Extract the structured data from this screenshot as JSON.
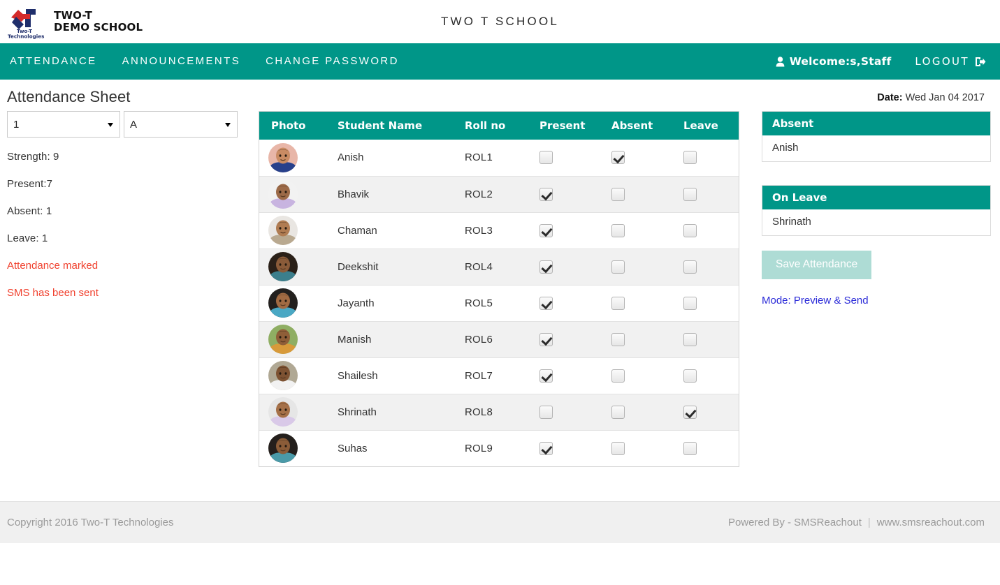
{
  "brand": {
    "logo_icon": "two-t-logo-icon",
    "logo_line1": "TWO-T",
    "logo_line2": "DEMO SCHOOL",
    "logo_sub1": "Two-T",
    "logo_sub2": "Technologies"
  },
  "header": {
    "school_title": "TWO T SCHOOL"
  },
  "nav": {
    "items": [
      {
        "label": "ATTENDANCE",
        "name": "nav-attendance"
      },
      {
        "label": "ANNOUNCEMENTS",
        "name": "nav-announcements"
      },
      {
        "label": "CHANGE PASSWORD",
        "name": "nav-change-password"
      }
    ],
    "welcome": "Welcome:s,Staff",
    "welcome_icon": "user-icon",
    "logout": "LOGOUT",
    "logout_icon": "sign-out-icon"
  },
  "page": {
    "title": "Attendance Sheet",
    "date_label": "Date:",
    "date_value": "Wed Jan 04 2017"
  },
  "filters": {
    "class_value": "1",
    "section_value": "A"
  },
  "stats": {
    "strength": "Strength: 9",
    "present": "Present:7",
    "absent": "Absent: 1",
    "leave": "Leave: 1",
    "message_marked": "Attendance marked",
    "message_sms": "SMS has been sent"
  },
  "table": {
    "columns": [
      "Photo",
      "Student Name",
      "Roll no",
      "Present",
      "Absent",
      "Leave"
    ],
    "rows": [
      {
        "name": "Anish",
        "roll": "ROL1",
        "present": false,
        "absent": true,
        "leave": false,
        "skin": "#c98b63",
        "shirt": "#27408b",
        "bg": "#e8b6a8"
      },
      {
        "name": "Bhavik",
        "roll": "ROL2",
        "present": true,
        "absent": false,
        "leave": false,
        "skin": "#9c6a48",
        "shirt": "#c8b4e0",
        "bg": "#f2f2f2"
      },
      {
        "name": "Chaman",
        "roll": "ROL3",
        "present": true,
        "absent": false,
        "leave": false,
        "skin": "#b07c52",
        "shirt": "#b9a990",
        "bg": "#e9e6e2"
      },
      {
        "name": "Deekshit",
        "roll": "ROL4",
        "present": true,
        "absent": false,
        "leave": false,
        "skin": "#8a5b39",
        "shirt": "#3c7f8c",
        "bg": "#2a2018"
      },
      {
        "name": "Jayanth",
        "roll": "ROL5",
        "present": true,
        "absent": false,
        "leave": false,
        "skin": "#a26b43",
        "shirt": "#4aa8c4",
        "bg": "#23201e"
      },
      {
        "name": "Manish",
        "roll": "ROL6",
        "present": true,
        "absent": false,
        "leave": false,
        "skin": "#8f5e38",
        "shirt": "#d89a3a",
        "bg": "#8fae63"
      },
      {
        "name": "Shailesh",
        "roll": "ROL7",
        "present": true,
        "absent": false,
        "leave": false,
        "skin": "#7d5232",
        "shirt": "#f2f2f2",
        "bg": "#b0a894"
      },
      {
        "name": "Shrinath",
        "roll": "ROL8",
        "present": false,
        "absent": false,
        "leave": true,
        "skin": "#a57048",
        "shirt": "#d9c9e8",
        "bg": "#e6e6e6"
      },
      {
        "name": "Suhas",
        "roll": "ROL9",
        "present": true,
        "absent": false,
        "leave": false,
        "skin": "#8b5c38",
        "shirt": "#4a9aa8",
        "bg": "#241f1c"
      }
    ]
  },
  "panels": {
    "absent": {
      "title": "Absent",
      "items": [
        "Anish"
      ]
    },
    "leave": {
      "title": "On Leave",
      "items": [
        "Shrinath"
      ]
    }
  },
  "actions": {
    "save_label": "Save Attendance",
    "mode_label": "Mode:",
    "mode_value": "Preview & Send"
  },
  "footer": {
    "copyright": "Copyright 2016 Two-T Technologies",
    "powered": "Powered By - SMSReachout",
    "separator": "|",
    "website": "www.smsreachout.com"
  },
  "colors": {
    "teal": "#009688",
    "alert_red": "#f0412e",
    "link_blue": "#2b2bd8",
    "save_disabled": "#aedcd5"
  }
}
